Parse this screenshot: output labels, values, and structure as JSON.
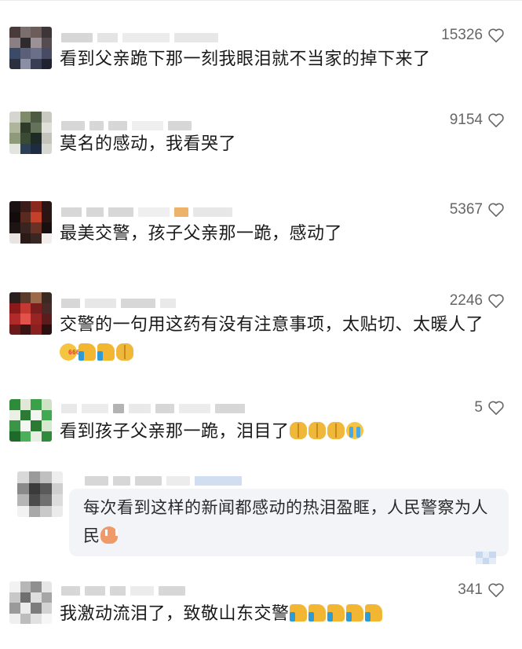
{
  "comments": [
    {
      "likes": "15326",
      "text": "看到父亲跪下那一刻我眼泪就不当家的掉下来了",
      "emojis": [],
      "avatar": [
        "#4a3b3a",
        "#7a6e6e",
        "#6c5c5a",
        "#3d3537",
        "#8a7f82",
        "#2f2a2d",
        "#9c9196",
        "#564c50",
        "#3b4a66",
        "#5a5f7a",
        "#6a7088",
        "#474b63",
        "#2b2f3e",
        "#8b8fa3",
        "#3a3e55",
        "#20232f"
      ]
    },
    {
      "likes": "9154",
      "text": "莫名的感动，我看哭了",
      "emojis": [],
      "avatar": [
        "#d6d6d0",
        "#7f8a6a",
        "#4f5a44",
        "#c9c9c0",
        "#aeb59a",
        "#2e3a2a",
        "#64725a",
        "#e0e0da",
        "#8e9a7a",
        "#3a4a33",
        "#1e2a25",
        "#c3c3bb",
        "#e4e4de",
        "#2d3f55",
        "#1d2c40",
        "#d8d8d2"
      ]
    },
    {
      "likes": "5367",
      "text": "最美交警，孩子父亲那一跪，感动了",
      "emojis": [],
      "avatar": [
        "#1a1212",
        "#3a1d1a",
        "#8a2a1e",
        "#2a1614",
        "#120c0c",
        "#5a2a20",
        "#c4402a",
        "#2a1512",
        "#1e1414",
        "#3a2420",
        "#6a3226",
        "#181010",
        "#e9e4e2",
        "#2a1a18",
        "#3a2622",
        "#f2eeec"
      ]
    },
    {
      "likes": "2246",
      "text": "交警的一句用这药有没有注意事项，太贴切、太暖人了",
      "emojis": [
        "wow",
        "thumb",
        "thumb",
        "pray"
      ],
      "avatar": [
        "#2a1f1f",
        "#5a3a2a",
        "#9a6a4a",
        "#3a2a22",
        "#8a1a1a",
        "#c43a32",
        "#7a1e1e",
        "#4a2a26",
        "#b02a2a",
        "#e2524a",
        "#9a2424",
        "#5a1c1c",
        "#6a1a1a",
        "#3a1414",
        "#8a2020",
        "#2a1010"
      ]
    },
    {
      "likes": "5",
      "text": "看到孩子父亲那一跪，泪目了",
      "emojis": [
        "pray",
        "pray",
        "pray",
        "cry"
      ],
      "avatar": [
        "#2e8b3a",
        "#dfe9d6",
        "#3aa04a",
        "#cfe2c6",
        "#e9f1e4",
        "#2c7a36",
        "#f1f6ee",
        "#43a852",
        "#3a9646",
        "#f2f7f0",
        "#2a7a34",
        "#d8e8d0",
        "#1f6a2a",
        "#4cb05a",
        "#e6efe1",
        "#2f8a3c"
      ]
    },
    {
      "likes": "341",
      "text": "我激动流泪了，致敬山东交警",
      "emojis": [
        "thumb",
        "thumb",
        "thumb",
        "thumb",
        "thumb"
      ],
      "avatar": [
        "#f2f2f2",
        "#b7b7b7",
        "#8f8f8f",
        "#e6e6e6",
        "#c8c8c8",
        "#6f6f6f",
        "#dedede",
        "#a6a6a6",
        "#9a9a9a",
        "#ececec",
        "#7c7c7c",
        "#d3d3d3",
        "#efefef",
        "#bdbdbd",
        "#e1e1e1",
        "#f6f6f6"
      ]
    }
  ],
  "reply": {
    "text": "每次看到这样的新闻都感动的热泪盈眶，人民警察为人民",
    "emojis": [
      "peace"
    ],
    "avatar": [
      "#d9d9d9",
      "#9a9a9a",
      "#c0c0c0",
      "#eeeeee",
      "#8a8a8a",
      "#3a3a3a",
      "#5a5a5a",
      "#cfcfcf",
      "#b5b5b5",
      "#4a4a4a",
      "#707070",
      "#dcdcdc",
      "#f2f2f2",
      "#a8a8a8",
      "#c9c9c9",
      "#ebebeb"
    ]
  },
  "icons": {
    "like": "heart-outline-icon"
  }
}
